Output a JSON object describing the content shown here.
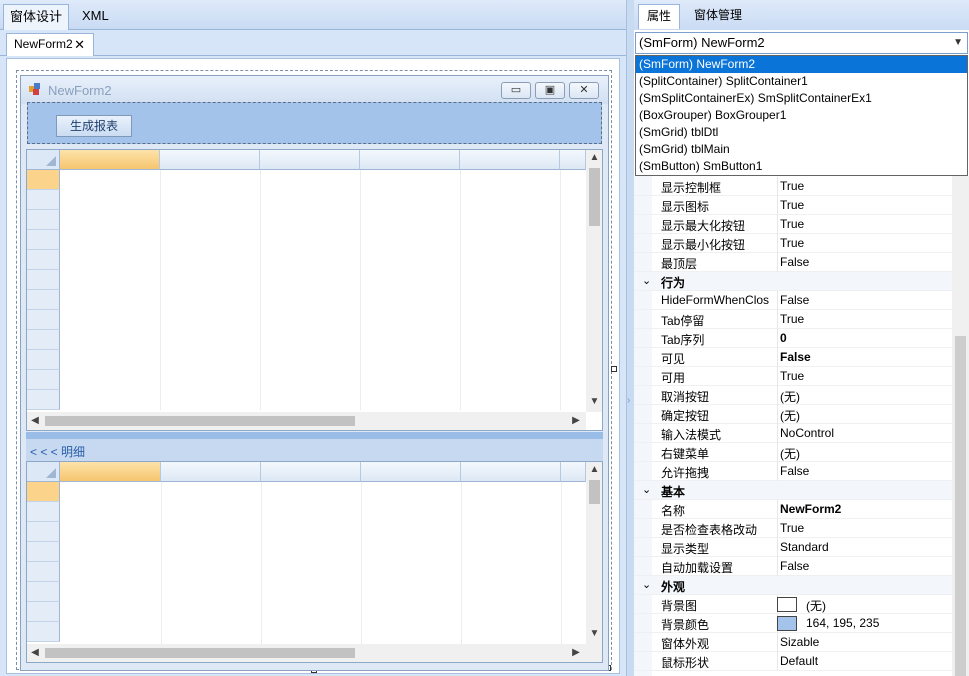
{
  "top_tabs": [
    "窗体设计",
    "XML"
  ],
  "doc_tab": {
    "label": "NewForm2",
    "close": "✕"
  },
  "form": {
    "title": "NewForm2",
    "minimize": "▭",
    "maximize": "▣",
    "close": "✕",
    "gen_report_button": "生成报表",
    "detail_label": "< < <  明细"
  },
  "right_tabs": [
    "属性",
    "窗体管理"
  ],
  "object_combo": {
    "value": "(SmForm) NewForm2"
  },
  "object_list": [
    "(SmForm) NewForm2",
    "(SplitContainer) SplitContainer1",
    "(SmSplitContainerEx) SmSplitContainerEx1",
    "(BoxGrouper) BoxGrouper1",
    "(SmGrid) tblDtl",
    "(SmGrid) tblMain",
    "(SmButton) SmButton1"
  ],
  "properties": [
    {
      "name": "显示控制框",
      "value": "True"
    },
    {
      "name": "显示图标",
      "value": "True"
    },
    {
      "name": "显示最大化按钮",
      "value": "True"
    },
    {
      "name": "显示最小化按钮",
      "value": "True"
    },
    {
      "name": "最顶层",
      "value": "False"
    },
    {
      "category": "行为"
    },
    {
      "name": "HideFormWhenClos",
      "value": "False"
    },
    {
      "name": "Tab停留",
      "value": "True"
    },
    {
      "name": "Tab序列",
      "value": "0",
      "bold": true
    },
    {
      "name": "可见",
      "value": "False",
      "bold": true
    },
    {
      "name": "可用",
      "value": "True"
    },
    {
      "name": "取消按钮",
      "value": "(无)"
    },
    {
      "name": "确定按钮",
      "value": "(无)"
    },
    {
      "name": "输入法模式",
      "value": "NoControl"
    },
    {
      "name": "右键菜单",
      "value": "(无)"
    },
    {
      "name": "允许拖拽",
      "value": "False"
    },
    {
      "category": "基本"
    },
    {
      "name": "名称",
      "value": "NewForm2",
      "bold": true
    },
    {
      "name": "是否检查表格改动",
      "value": "True"
    },
    {
      "name": "显示类型",
      "value": "Standard"
    },
    {
      "name": "自动加载设置",
      "value": "False"
    },
    {
      "category": "外观"
    },
    {
      "name": "背景图",
      "value": "(无)",
      "swatch": "#ffffff"
    },
    {
      "name": "背景颜色",
      "value": "164, 195, 235",
      "swatch": "#a4c3eb"
    },
    {
      "name": "窗体外观",
      "value": "Sizable"
    },
    {
      "name": "鼠标形状",
      "value": "Default"
    }
  ],
  "colors": {
    "form_bg": "#a4c3eb",
    "selection": "#0a74d8",
    "grid_selected_header": "#f6c56f"
  }
}
